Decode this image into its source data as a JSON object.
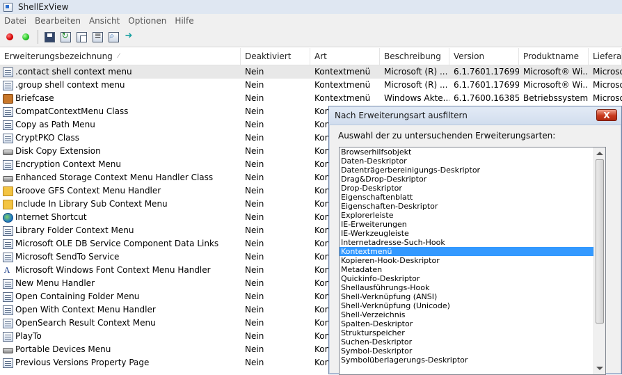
{
  "window": {
    "title": "ShellExView"
  },
  "menubar": {
    "items": [
      "Datei",
      "Bearbeiten",
      "Ansicht",
      "Optionen",
      "Hilfe"
    ]
  },
  "toolbar": {
    "buttons": [
      "disable-red-dot-icon",
      "enable-green-dot-icon",
      "save-icon",
      "refresh-icon",
      "copy-icon",
      "properties-icon",
      "find-icon",
      "exit-icon"
    ]
  },
  "columns": [
    "Erweiterungsbezeichnung",
    "Deaktiviert",
    "Art",
    "Beschreibung",
    "Version",
    "Produktname",
    "Lieferant"
  ],
  "rows": [
    {
      "icon": "doc",
      "name": ".contact shell context menu",
      "disabled": "Nein",
      "type": "Kontextmenü",
      "description": "Microsoft (R) ...",
      "version": "6.1.7601.17699 ...",
      "product": "Microsoft® Wi...",
      "vendor": "Microso"
    },
    {
      "icon": "doc",
      "name": ".group shell context menu",
      "disabled": "Nein",
      "type": "Kontextmenü",
      "description": "Microsoft (R) ...",
      "version": "6.1.7601.17699 ...",
      "product": "Microsoft® Wi...",
      "vendor": "Microso"
    },
    {
      "icon": "brief",
      "name": "Briefcase",
      "disabled": "Nein",
      "type": "Kontextmenü",
      "description": "Windows Akte...",
      "version": "6.1.7600.16385 ...",
      "product": "Betriebssystem...",
      "vendor": "Microso"
    },
    {
      "icon": "doc",
      "name": "CompatContextMenu Class",
      "disabled": "Nein",
      "type": "Kont",
      "description": "",
      "version": "",
      "product": "",
      "vendor": ""
    },
    {
      "icon": "doc",
      "name": "Copy as Path Menu",
      "disabled": "Nein",
      "type": "Kont",
      "description": "",
      "version": "",
      "product": "",
      "vendor": ""
    },
    {
      "icon": "doc",
      "name": "CryptPKO Class",
      "disabled": "Nein",
      "type": "Kont",
      "description": "",
      "version": "",
      "product": "",
      "vendor": ""
    },
    {
      "icon": "drive",
      "name": "Disk Copy Extension",
      "disabled": "Nein",
      "type": "Kont",
      "description": "",
      "version": "",
      "product": "",
      "vendor": ""
    },
    {
      "icon": "doc",
      "name": "Encryption Context Menu",
      "disabled": "Nein",
      "type": "Kont",
      "description": "",
      "version": "",
      "product": "",
      "vendor": ""
    },
    {
      "icon": "drive",
      "name": "Enhanced Storage Context Menu Handler Class",
      "disabled": "Nein",
      "type": "Kont",
      "description": "",
      "version": "",
      "product": "",
      "vendor": ""
    },
    {
      "icon": "folder",
      "name": "Groove GFS Context Menu Handler",
      "disabled": "Nein",
      "type": "Kont",
      "description": "",
      "version": "",
      "product": "",
      "vendor": ""
    },
    {
      "icon": "folder",
      "name": "Include In Library Sub Context Menu",
      "disabled": "Nein",
      "type": "Kont",
      "description": "",
      "version": "",
      "product": "",
      "vendor": ""
    },
    {
      "icon": "globe",
      "name": "Internet Shortcut",
      "disabled": "Nein",
      "type": "Kont",
      "description": "",
      "version": "",
      "product": "",
      "vendor": ""
    },
    {
      "icon": "doc",
      "name": "Library Folder Context Menu",
      "disabled": "Nein",
      "type": "Kont",
      "description": "",
      "version": "",
      "product": "",
      "vendor": ""
    },
    {
      "icon": "doc",
      "name": "Microsoft OLE DB Service Component Data Links",
      "disabled": "Nein",
      "type": "Kont",
      "description": "",
      "version": "",
      "product": "",
      "vendor": ""
    },
    {
      "icon": "doc",
      "name": "Microsoft SendTo Service",
      "disabled": "Nein",
      "type": "Kont",
      "description": "",
      "version": "",
      "product": "",
      "vendor": ""
    },
    {
      "icon": "font",
      "name": "Microsoft Windows Font Context Menu Handler",
      "disabled": "Nein",
      "type": "Kont",
      "description": "",
      "version": "",
      "product": "",
      "vendor": ""
    },
    {
      "icon": "doc",
      "name": "New Menu Handler",
      "disabled": "Nein",
      "type": "Kont",
      "description": "",
      "version": "",
      "product": "",
      "vendor": ""
    },
    {
      "icon": "doc",
      "name": "Open Containing Folder Menu",
      "disabled": "Nein",
      "type": "Kont",
      "description": "",
      "version": "",
      "product": "",
      "vendor": ""
    },
    {
      "icon": "doc",
      "name": "Open With Context Menu Handler",
      "disabled": "Nein",
      "type": "Kont",
      "description": "",
      "version": "",
      "product": "",
      "vendor": ""
    },
    {
      "icon": "doc",
      "name": "OpenSearch Result Context Menu",
      "disabled": "Nein",
      "type": "Kont",
      "description": "",
      "version": "",
      "product": "",
      "vendor": ""
    },
    {
      "icon": "doc",
      "name": "PlayTo",
      "disabled": "Nein",
      "type": "Kont",
      "description": "",
      "version": "",
      "product": "",
      "vendor": ""
    },
    {
      "icon": "drive",
      "name": "Portable Devices Menu",
      "disabled": "Nein",
      "type": "Kont",
      "description": "",
      "version": "",
      "product": "",
      "vendor": ""
    },
    {
      "icon": "doc",
      "name": "Previous Versions Property Page",
      "disabled": "Nein",
      "type": "Kont",
      "description": "",
      "version": "",
      "product": "",
      "vendor": ""
    }
  ],
  "dialog": {
    "title": "Nach Erweiterungsart ausfiltern",
    "close_label": "X",
    "prompt": "Auswahl der zu untersuchenden Erweiterungsarten:",
    "selected_index": 11,
    "options": [
      "Browserhilfsobjekt",
      "Daten-Deskriptor",
      "Datenträgerbereinigungs-Deskriptor",
      "Drag&Drop-Deskriptor",
      "Drop-Deskriptor",
      "Eigenschaftenblatt",
      "Eigenschaften-Deskriptor",
      "Explorerleiste",
      "IE-Erweiterungen",
      "IE-Werkzeugleiste",
      "Internetadresse-Such-Hook",
      "Kontextmenü",
      "Kopieren-Hook-Deskriptor",
      "Metadaten",
      "Quickinfo-Deskriptor",
      "Shellausführungs-Hook",
      "Shell-Verknüpfung (ANSI)",
      "Shell-Verknüpfung (Unicode)",
      "Shell-Verzeichnis",
      "Spalten-Deskriptor",
      "Strukturspeicher",
      "Suchen-Deskriptor",
      "Symbol-Deskriptor",
      "Symbolüberlagerungs-Deskriptor"
    ]
  }
}
